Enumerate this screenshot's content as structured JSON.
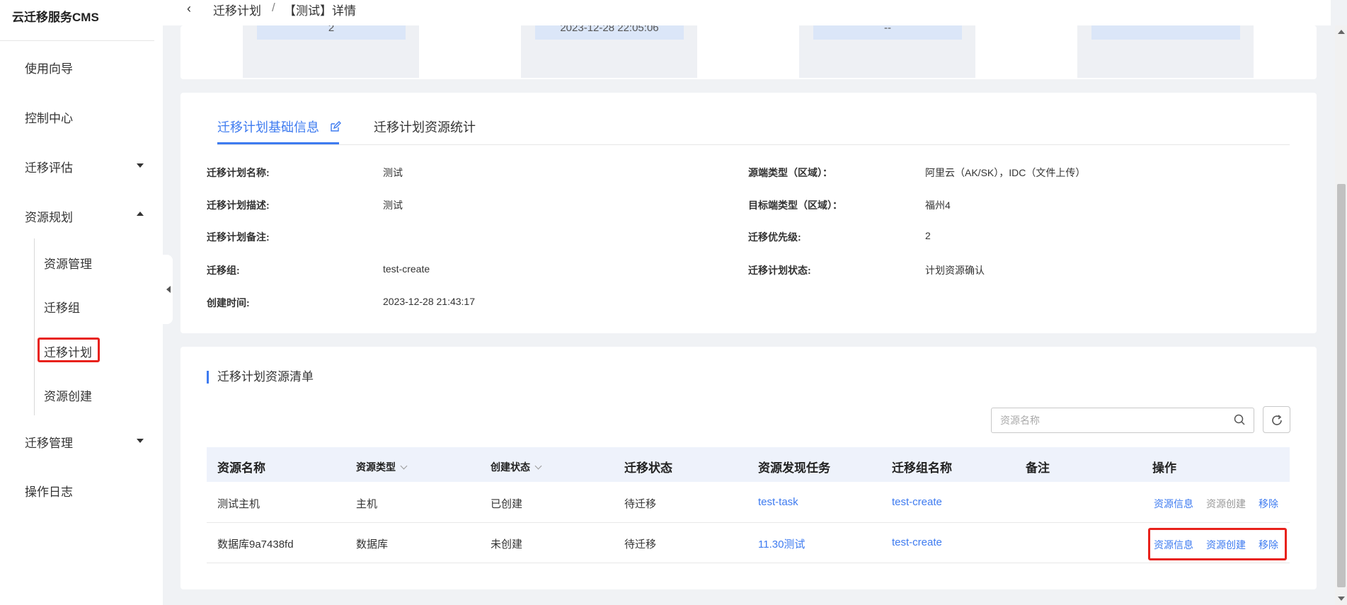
{
  "brand": "云迁移服务CMS",
  "sidebar": {
    "items": [
      {
        "label": "使用向导"
      },
      {
        "label": "控制中心"
      },
      {
        "label": "迁移评估"
      },
      {
        "label": "资源规划"
      },
      {
        "label": "迁移管理"
      },
      {
        "label": "操作日志"
      }
    ],
    "sub_items": [
      {
        "label": "资源管理"
      },
      {
        "label": "迁移组"
      },
      {
        "label": "迁移计划",
        "active": true
      },
      {
        "label": "资源创建"
      }
    ]
  },
  "breadcrumb": {
    "parent": "迁移计划",
    "separator": "/",
    "current": "【测试】详情"
  },
  "stats": [
    "2",
    "2023-12-28 22:05:06",
    "--",
    ""
  ],
  "tabs": [
    {
      "label": "迁移计划基础信息",
      "active": true
    },
    {
      "label": "迁移计划资源统计"
    }
  ],
  "info": {
    "left": [
      {
        "label": "迁移计划名称:",
        "value": "测试"
      },
      {
        "label": "迁移计划描述:",
        "value": "测试"
      },
      {
        "label": "迁移计划备注:",
        "value": ""
      },
      {
        "label": "迁移组:",
        "value": "test-create"
      },
      {
        "label": "创建时间:",
        "value": "2023-12-28 21:43:17"
      }
    ],
    "right": [
      {
        "label": "源端类型（区域）：",
        "value": "阿里云（AK/SK），IDC（文件上传）"
      },
      {
        "label": "目标端类型（区域）：",
        "value": "福州4"
      },
      {
        "label": "迁移优先级:",
        "value": "2"
      },
      {
        "label": "迁移计划状态:",
        "value": "计划资源确认"
      }
    ]
  },
  "resource_list": {
    "title": "迁移计划资源清单",
    "search_placeholder": "资源名称",
    "columns": [
      "资源名称",
      "资源类型",
      "创建状态",
      "迁移状态",
      "资源发现任务",
      "迁移组名称",
      "备注",
      "操作"
    ],
    "rows": [
      {
        "name": "测试主机",
        "type": "主机",
        "create_status": "已创建",
        "migrate_status": "待迁移",
        "task": "test-task",
        "group": "test-create",
        "note": "",
        "ops": [
          "资源信息",
          "资源创建",
          "移除"
        ]
      },
      {
        "name": "数据库9a7438fd",
        "type": "数据库",
        "create_status": "未创建",
        "migrate_status": "待迁移",
        "task": "11.30测试",
        "group": "test-create",
        "note": "",
        "ops": [
          "资源信息",
          "资源创建",
          "移除"
        ]
      }
    ]
  },
  "colors": {
    "accent": "#3e7bf0",
    "highlight": "#e8211b"
  }
}
